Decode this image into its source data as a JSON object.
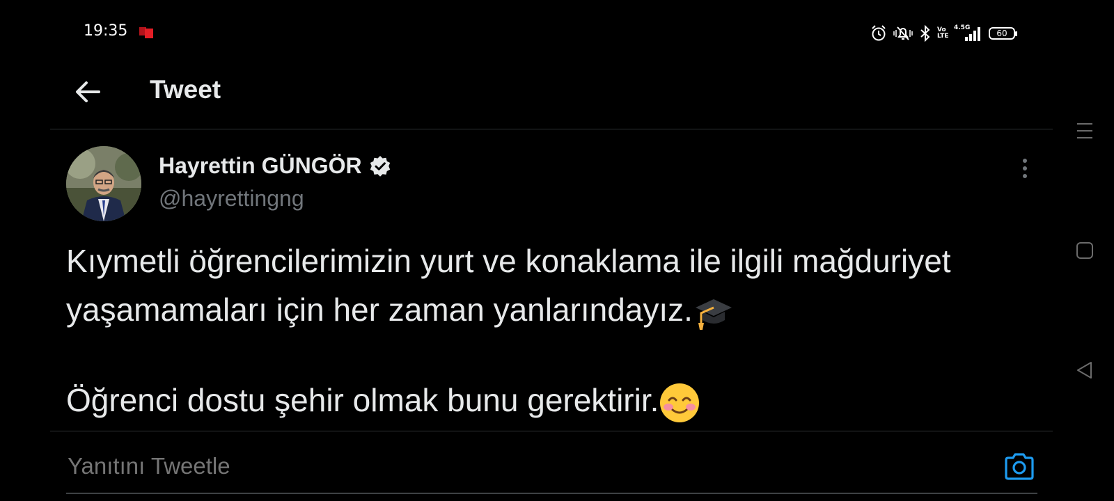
{
  "status_bar": {
    "time": "19:35",
    "network": "4.5G",
    "volte": "Vo LTE",
    "battery": "60"
  },
  "header": {
    "title": "Tweet"
  },
  "tweet": {
    "author_name": "Hayrettin GÜNGÖR",
    "author_handle": "@hayrettingng",
    "paragraph_1": "Kıymetli öğrencilerimizin yurt ve konaklama ile ilgili mağduriyet yaşamamaları için her zaman yanlarındayız.",
    "paragraph_2": "Öğrenci dostu şehir olmak bunu gerektirir.",
    "verified_color": "#E7E9EA"
  },
  "reply": {
    "placeholder": "Yanıtını Tweetle",
    "accent_color": "#1D9BF0"
  },
  "icons": [
    "back-arrow-icon",
    "verified-badge-icon",
    "more-options-icon",
    "graduation-cap-emoji",
    "smiling-face-emoji",
    "camera-icon",
    "alarm-icon",
    "mute-icon",
    "bluetooth-icon",
    "signal-icon",
    "battery-icon",
    "menu-icon",
    "home-square-icon",
    "back-triangle-icon"
  ]
}
